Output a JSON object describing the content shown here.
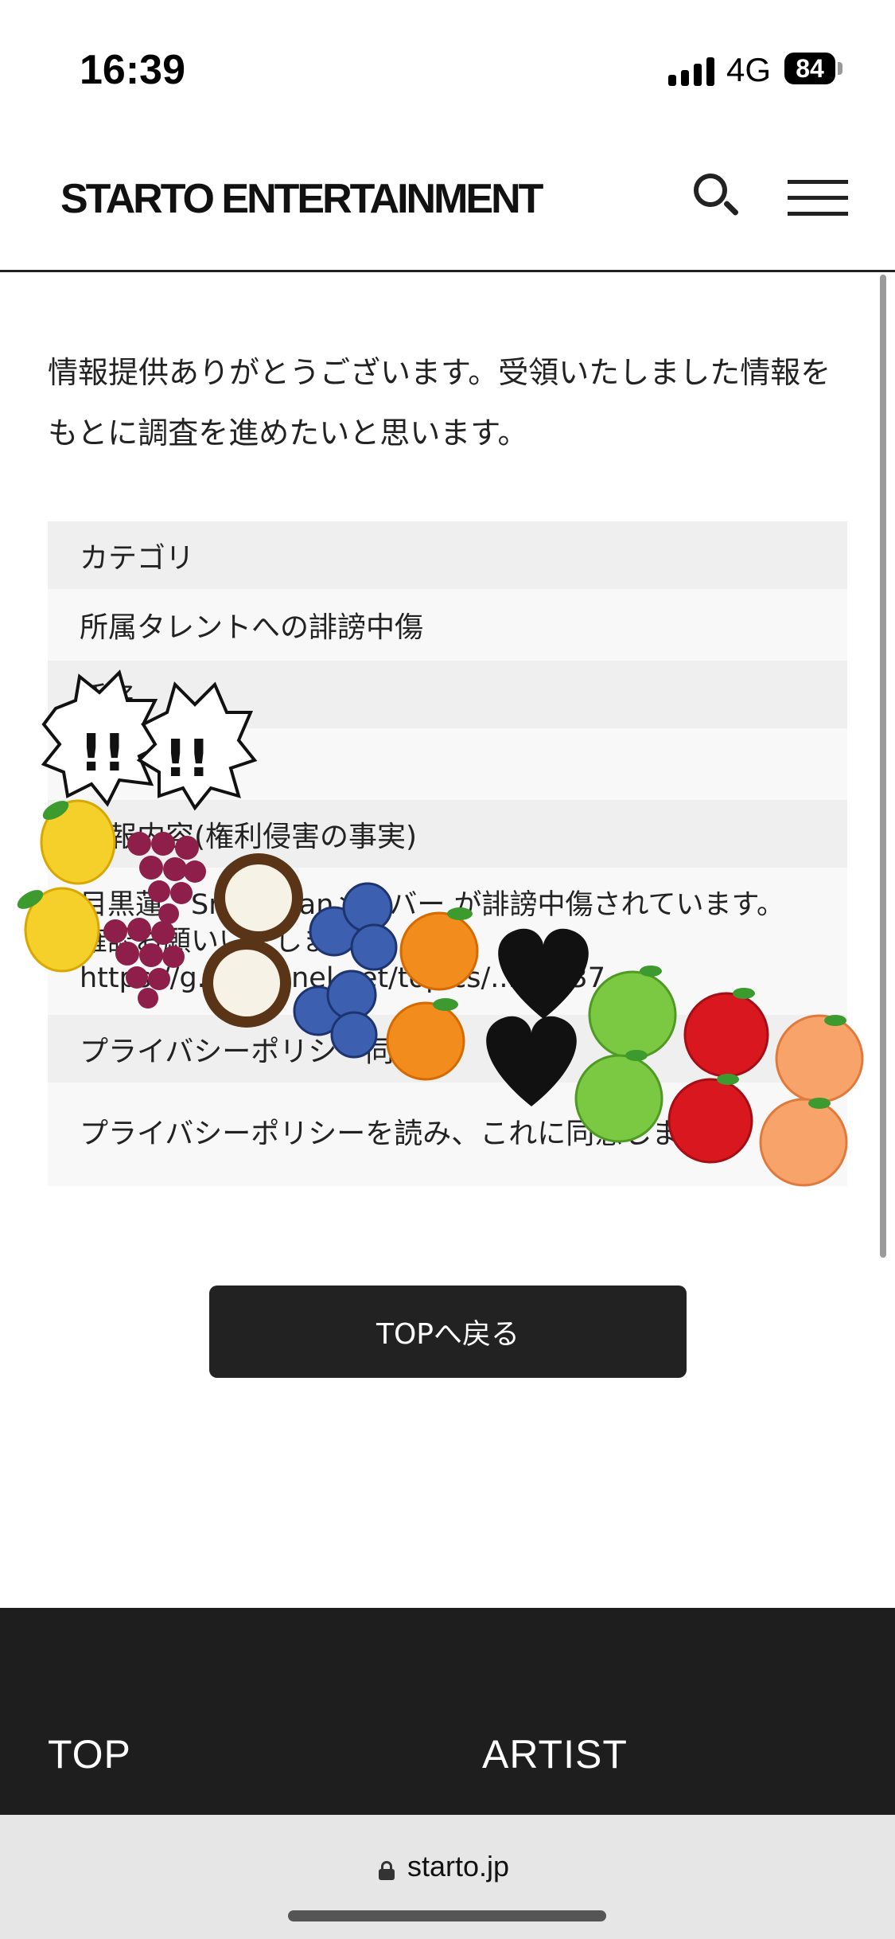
{
  "status_bar": {
    "time": "16:39",
    "network": "4G",
    "battery": "84"
  },
  "header": {
    "logo": "STARTO ENTERTAINMENT"
  },
  "main": {
    "thanks_message": "情報提供ありがとうございます。受領いたしました情報をもとに調査を進めたいと思います。",
    "fields": [
      {
        "label": "カテゴリ",
        "value": "所属タレントへの誹謗中傷"
      },
      {
        "label": "氏名",
        "value": ""
      },
      {
        "label": "情報内容(権利侵害の事実)",
        "value": "目黒蓮、Snow Manメンバー が誹謗中傷されています。 確認お願いいたします。 https://g...channel.net/topics/...29837"
      },
      {
        "label": "プライバシーポリシー同意",
        "value": "プライバシーポリシーを読み、これに同意します。"
      }
    ],
    "top_button": "TOPへ戻る"
  },
  "footer": {
    "links": [
      "TOP",
      "ARTIST"
    ]
  },
  "browser": {
    "url": "starto.jp"
  },
  "stickers": {
    "exclaim_1": "!!",
    "exclaim_2": "!!"
  },
  "colors": {
    "dark": "#222222",
    "footer_bg": "#1e1e1e",
    "table_head": "#efefef",
    "table_value": "#f8f8f8"
  }
}
